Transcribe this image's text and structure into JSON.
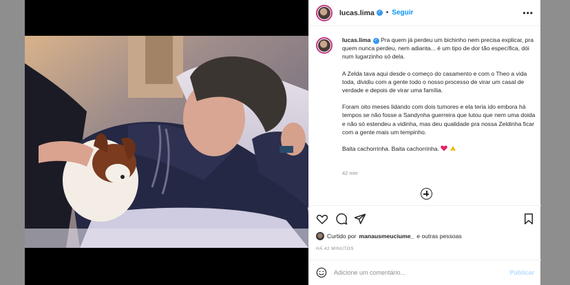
{
  "header": {
    "username": "lucas.lima",
    "verified_glyph": "✓",
    "separator": "•",
    "follow_label": "Seguir",
    "more_label": "•••"
  },
  "caption": {
    "username": "lucas.lima",
    "paragraphs": [
      "Pra quem já perdeu um bichinho nem precisa explicar, pra quem nunca perdeu, nem adianta... é um tipo de dor tão específica, dói num lugarzinho só dela.",
      "A Zelda tava aqui desde o começo do casamento e com o Theo a vida toda, dividiu com a gente todo o nosso processo de virar um casal de verdade e depois de virar uma família.",
      "Foram oito meses lidando com dois tumores e ela teria ido embora há tempos se não fosse a Sandynha guerreira que lutou que nem uma doida e não só estendeu a vidinha, mas deu qualidade pra nossa Zeldinha ficar com a gente mais um tempinho.",
      "Baita cachorrinha. Baita cachorrinha."
    ],
    "time_ago": "42 min"
  },
  "actions": {
    "icons": [
      "heart-icon",
      "comment-icon",
      "share-icon",
      "bookmark-icon"
    ]
  },
  "likes": {
    "prefix": "Curtido por",
    "user": "manausmeuciume_",
    "suffix": "e outras pessoas"
  },
  "posted": "HÁ 42 MINUTOS",
  "comment": {
    "placeholder": "Adicione um comentário...",
    "publish_label": "Publicar"
  },
  "colors": {
    "accent": "#0095f6",
    "verified": "#3897f0",
    "text": "#262626",
    "muted": "#8e8e8e",
    "publish_disabled": "#b3dbff"
  }
}
